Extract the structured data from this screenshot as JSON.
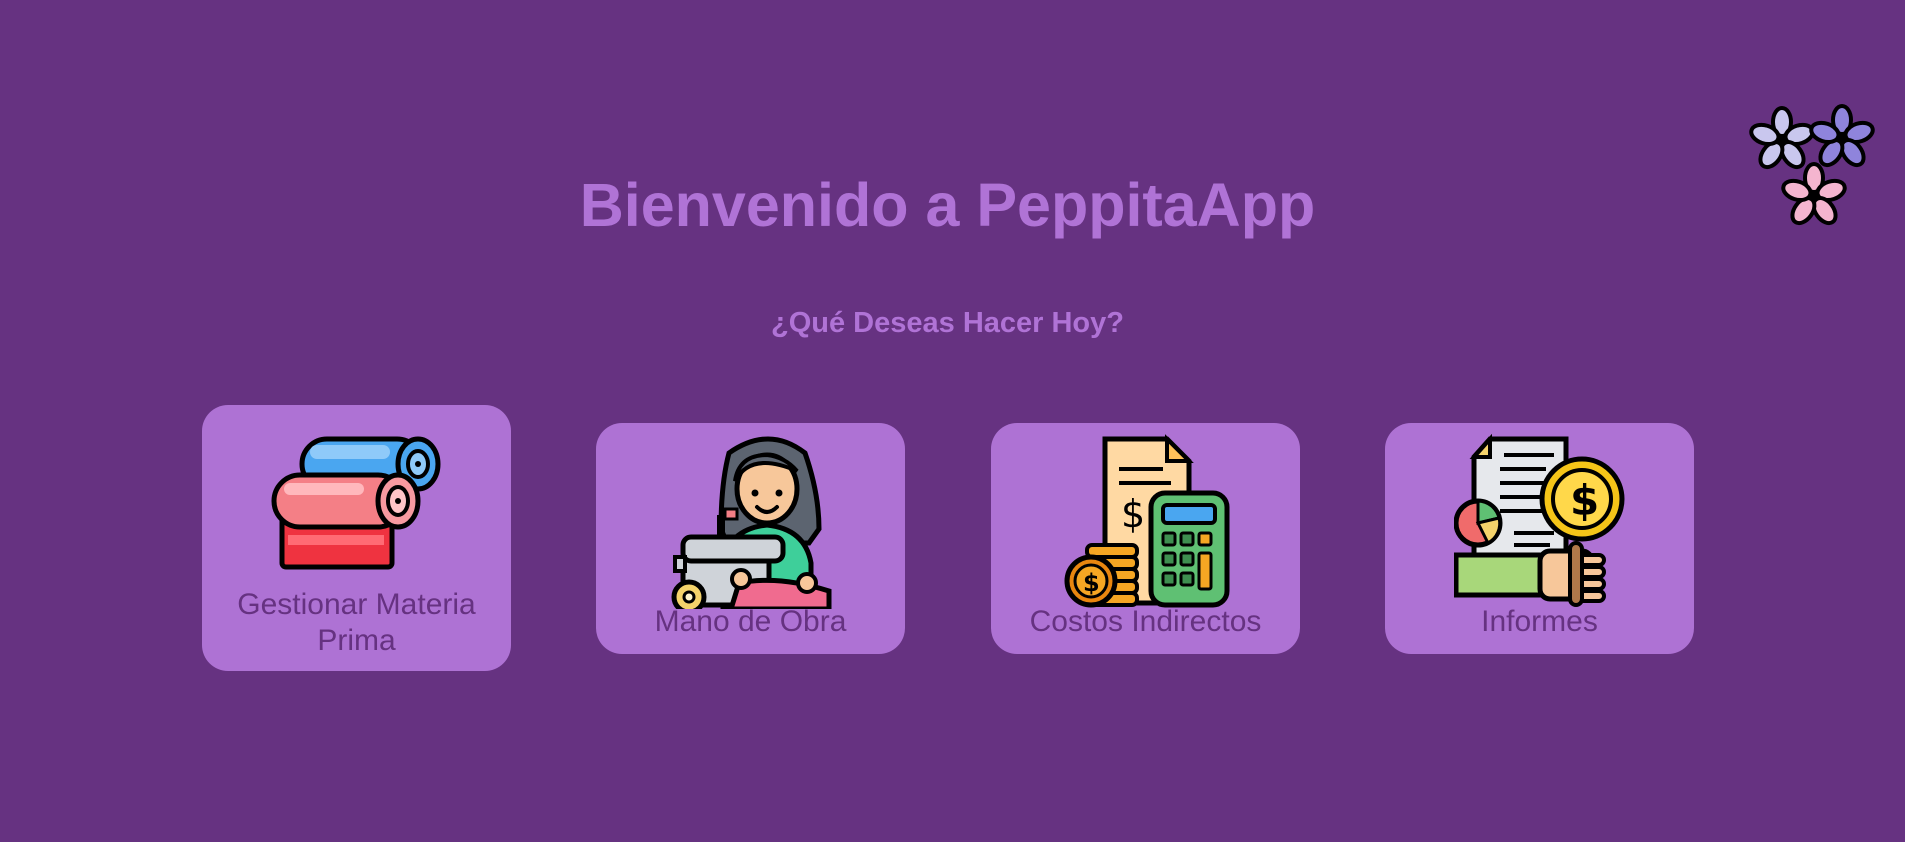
{
  "header": {
    "title": "Bienvenido a PeppitaApp",
    "subtitle": "¿Qué Deseas Hacer Hoy?",
    "logo_icon": "flower-cluster-logo-icon"
  },
  "cards": [
    {
      "label": "Gestionar Materia Prima",
      "icon": "fabric-rolls-icon"
    },
    {
      "label": "Mano de Obra",
      "icon": "seamstress-sewing-machine-icon"
    },
    {
      "label": "Costos Indirectos",
      "icon": "receipt-calculator-coins-icon"
    },
    {
      "label": "Informes",
      "icon": "report-hand-coin-icon"
    }
  ],
  "colors": {
    "background": "#663281",
    "card": "#ae72d4",
    "title": "#b073d6",
    "card_text": "#663281"
  }
}
